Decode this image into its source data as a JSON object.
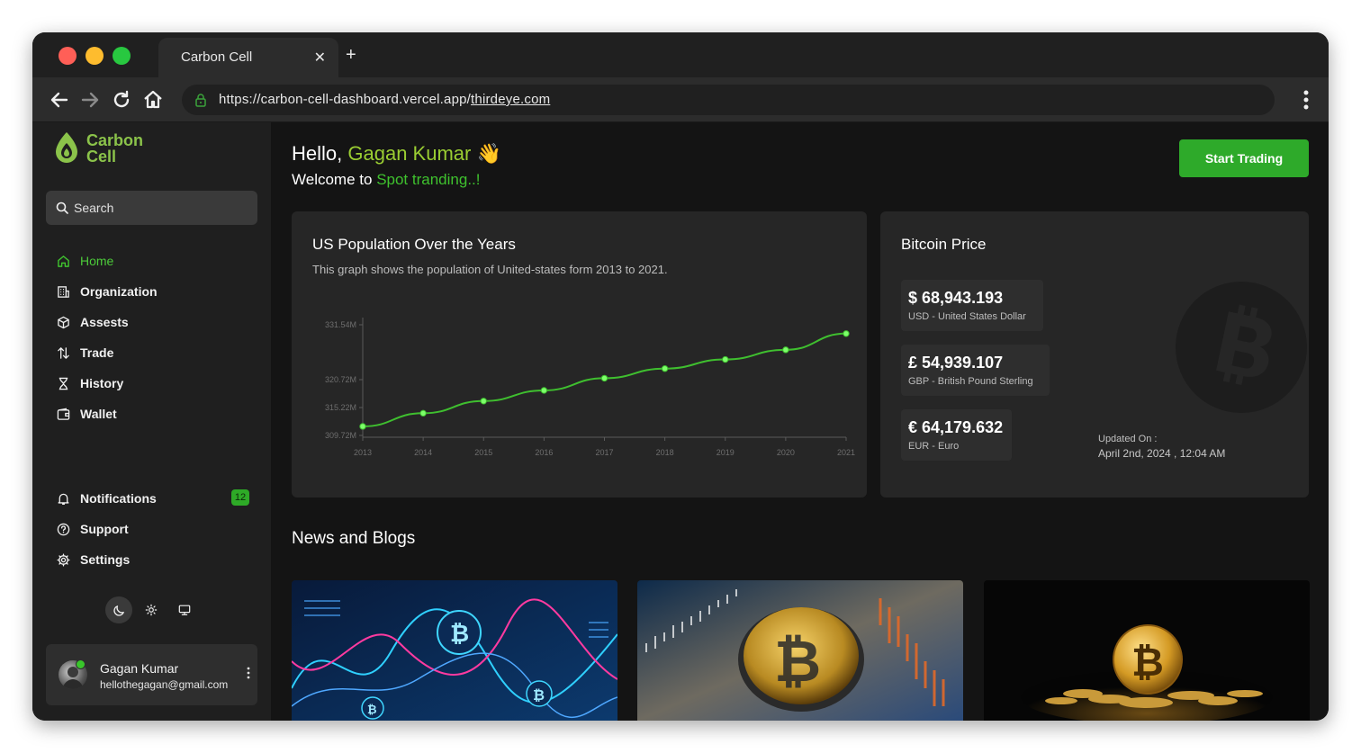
{
  "browser": {
    "tab_title": "Carbon Cell",
    "tab_close": "✕",
    "new_tab": "+",
    "url_base": "https://carbon-cell-dashboard.vercel.app/",
    "url_path": "thirdeye.com"
  },
  "sidebar": {
    "logo_line1": "Carbon",
    "logo_line2": "Cell",
    "search_label": "Search",
    "nav_items": [
      {
        "label": "Home",
        "icon": "home-icon",
        "active": true
      },
      {
        "label": "Organization",
        "icon": "building-icon"
      },
      {
        "label": "Assests",
        "icon": "cube-icon"
      },
      {
        "label": "Trade",
        "icon": "arrows-updown-icon"
      },
      {
        "label": "History",
        "icon": "hourglass-icon"
      },
      {
        "label": "Wallet",
        "icon": "wallet-icon"
      }
    ],
    "bottom_items": [
      {
        "label": "Notifications",
        "icon": "bell-icon",
        "badge": "12"
      },
      {
        "label": "Support",
        "icon": "help-circle-icon"
      },
      {
        "label": "Settings",
        "icon": "gear-icon"
      }
    ],
    "theme_options": [
      "moon-icon",
      "sun-icon",
      "monitor-icon"
    ],
    "user": {
      "name": "Gagan Kumar",
      "email": "hellothegagan@gmail.com"
    }
  },
  "header": {
    "hello": "Hello,",
    "user_name": "Gagan Kumar",
    "wave": "👋",
    "welcome": "Welcome to",
    "welcome_highlight": "Spot tranding..!",
    "start_button": "Start Trading"
  },
  "population_card": {
    "title": "US Population Over the Years",
    "subtitle": "This graph shows the population of United-states form 2013 to 2021."
  },
  "chart_data": {
    "type": "line",
    "title": "US Population Over the Years",
    "categories": [
      "2013",
      "2014",
      "2015",
      "2016",
      "2017",
      "2018",
      "2019",
      "2020",
      "2021"
    ],
    "x_tick_labels": [
      "2013",
      "2014",
      "2015",
      "2016",
      "2017",
      "2018",
      "2019",
      "2020",
      "2021"
    ],
    "y_tick_labels": [
      "331.54M",
      "320.72M",
      "315.22M",
      "309.72M"
    ],
    "ylim": [
      309.72,
      331.54
    ],
    "series": [
      {
        "values": [
          311.5,
          314.1,
          316.5,
          318.6,
          321.0,
          322.9,
          324.7,
          326.6,
          329.8
        ],
        "color": "#3fbf2f"
      }
    ],
    "grid": false
  },
  "bitcoin_card": {
    "title": "Bitcoin Price",
    "prices": [
      {
        "value": "$ 68,943.193",
        "label": "USD - United States Dollar"
      },
      {
        "value": "£ 54,939.107",
        "label": "GBP - British Pound Sterling"
      },
      {
        "value": "€ 64,179.632",
        "label": "EUR - Euro"
      }
    ],
    "updated_label": "Updated On :",
    "updated_value": "April 2nd, 2024 , 12:04 AM"
  },
  "news": {
    "title": "News and Blogs",
    "images": [
      "bitcoin-chart-image",
      "bitcoin-coin-market-image",
      "bitcoin-coin-pile-image"
    ]
  },
  "colors": {
    "accent_green": "#2eaa2a",
    "name_green": "#9acd32",
    "background": "#141414",
    "card": "#262626"
  }
}
